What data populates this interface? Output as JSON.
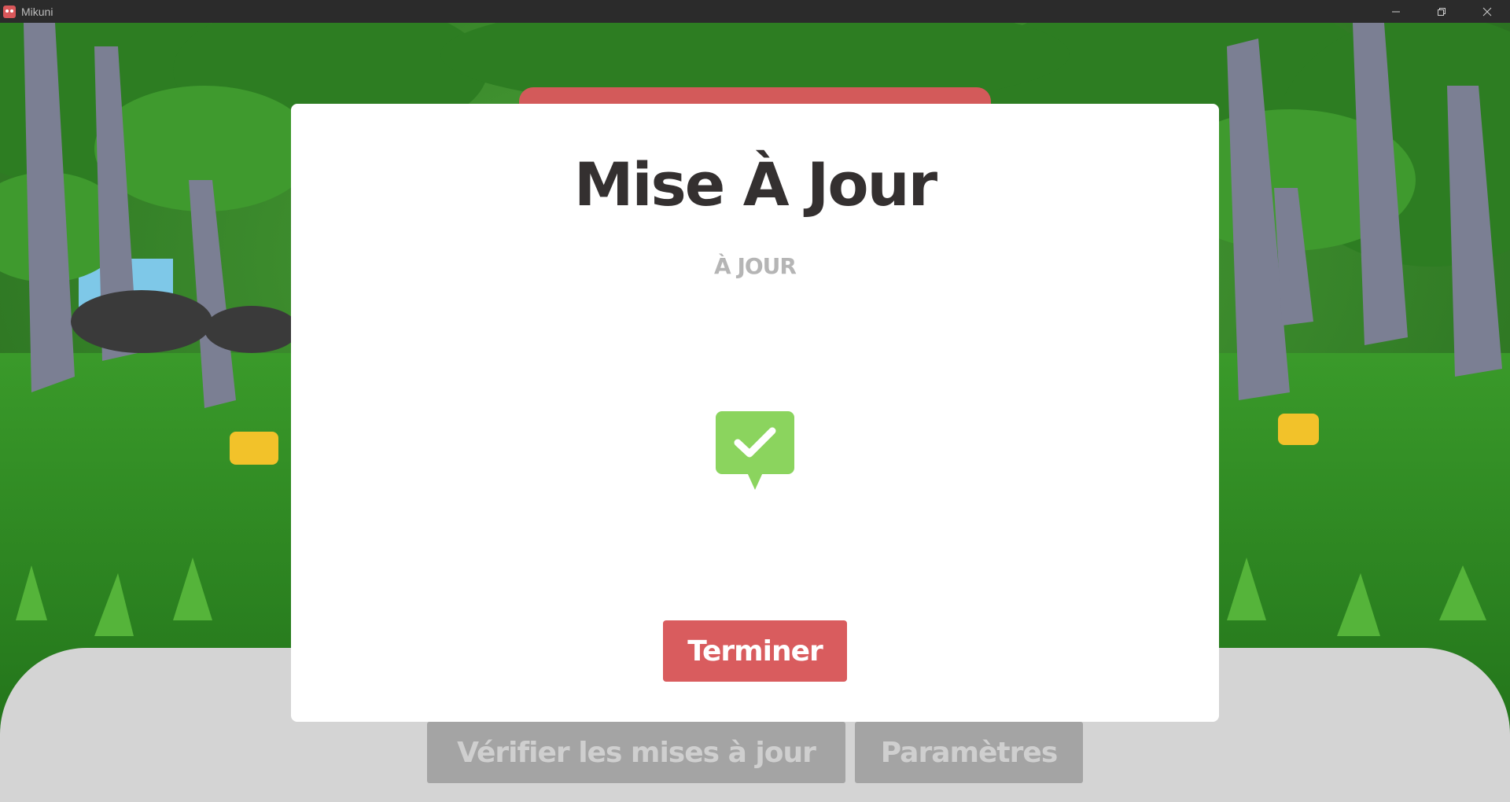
{
  "window": {
    "title": "Mikuni",
    "controls": [
      "minimize-icon",
      "restore-icon",
      "close-icon"
    ]
  },
  "modal": {
    "title": "Mise À Jour",
    "status": "À JOUR",
    "status_icon": "check-badge-icon",
    "finish_label": "Terminer"
  },
  "bottom_bar": {
    "check_updates_label": "Vérifier les mises à jour",
    "settings_label": "Paramètres"
  },
  "colors": {
    "accent_red": "#d95c5e",
    "success_green": "#8bd45e",
    "disabled_gray": "#a4a4a4"
  }
}
